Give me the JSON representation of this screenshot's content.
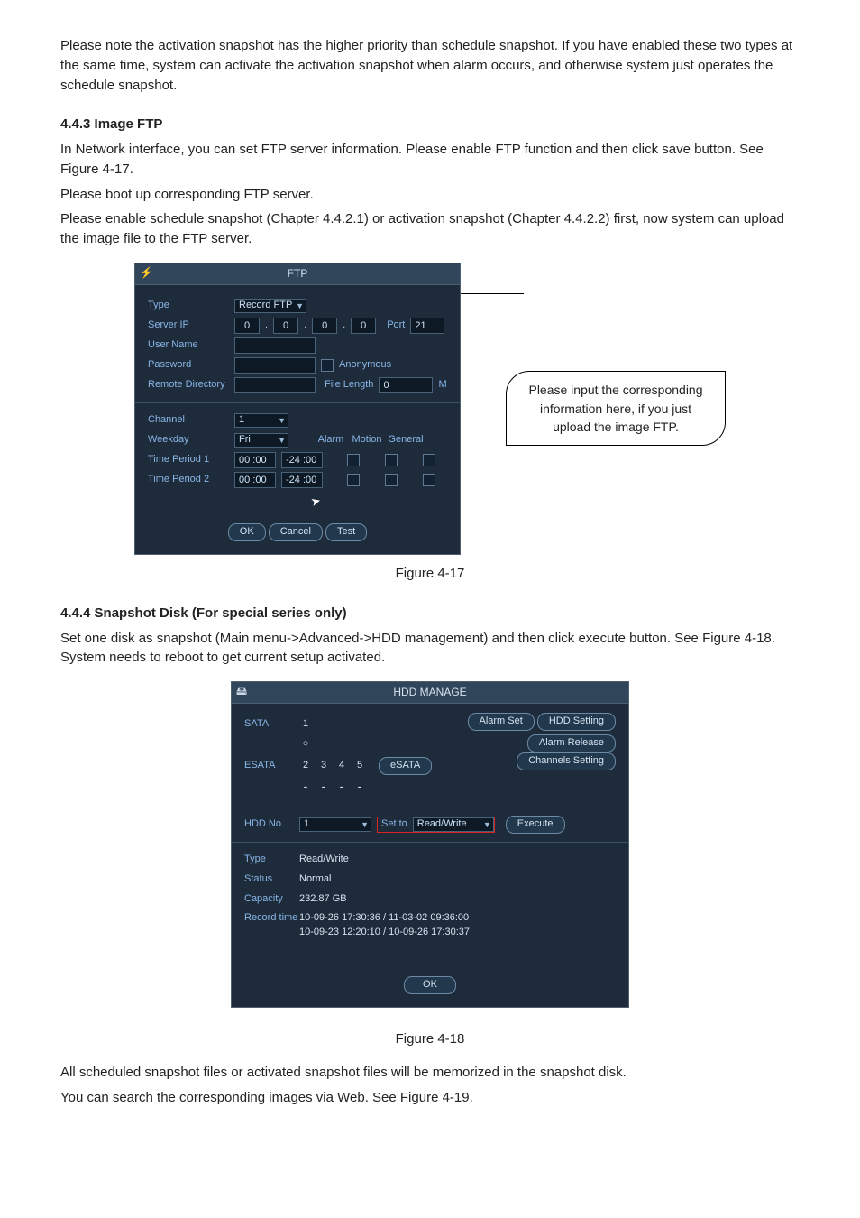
{
  "intro": {
    "p1": "Please note the activation snapshot has the higher priority than schedule snapshot. If you have enabled these two types at the same time, system can activate the activation snapshot when alarm occurs, and otherwise system just operates the schedule snapshot."
  },
  "s443": {
    "heading": "4.4.3  Image FTP",
    "p1": "In Network interface, you can set FTP server information. Please enable FTP function and then click save button. See Figure 4-17.",
    "p2": "Please boot up corresponding FTP server.",
    "p3": "Please enable schedule snapshot (Chapter 4.4.2.1) or activation snapshot (Chapter 4.4.2.2) first, now system can upload the image file to the FTP server."
  },
  "ftp": {
    "title": "FTP",
    "labels": {
      "type": "Type",
      "serverip": "Server IP",
      "username": "User Name",
      "password": "Password",
      "remotedir": "Remote Directory",
      "anonymous": "Anonymous",
      "filelength": "File Length",
      "port": "Port",
      "m": "M",
      "channel": "Channel",
      "weekday": "Weekday",
      "tp1": "Time Period 1",
      "tp2": "Time Period 2",
      "alarm": "Alarm",
      "motion": "Motion",
      "general": "General"
    },
    "values": {
      "type": "Record FTP",
      "ip1": "0",
      "ip2": "0",
      "ip3": "0",
      "ip4": "0",
      "port": "21",
      "filelength": "0",
      "channel": "1",
      "weekday": "Fri",
      "tp1a": "00 :00",
      "tp1b": "-24 :00",
      "tp2a": "00 :00",
      "tp2b": "-24 :00"
    },
    "buttons": {
      "ok": "OK",
      "cancel": "Cancel",
      "test": "Test"
    }
  },
  "callout": "Please input the corresponding information here, if you just upload the image FTP.",
  "fig417": "Figure 4-17",
  "s444": {
    "heading": "4.4.4  Snapshot Disk (For special series only)",
    "p1": "Set one disk as snapshot (Main menu->Advanced->HDD management) and then click execute button. See Figure 4-18. System needs to reboot to get current setup activated."
  },
  "hdd": {
    "title": "HDD MANAGE",
    "labels": {
      "sata": "SATA",
      "esata": "ESATA",
      "hddno": "HDD No.",
      "setto": "Set to",
      "type": "Type",
      "status": "Status",
      "capacity": "Capacity",
      "recordtime": "Record time"
    },
    "values": {
      "sata_row1": [
        "1",
        "",
        "",
        "",
        ""
      ],
      "sata_row2": [
        "○",
        "",
        "",
        "",
        ""
      ],
      "esata_row1": [
        "2",
        "3",
        "4",
        "5"
      ],
      "esata_row2": [
        "-",
        "-",
        "-",
        "-"
      ],
      "hddno": "1",
      "setto": "Read/Write",
      "type": "Read/Write",
      "status": "Normal",
      "capacity": "232.87 GB",
      "rt1": "10-09-26 17:30:36 / 11-03-02 09:36:00",
      "rt2": "10-09-23 12:20:10 / 10-09-26 17:30:37"
    },
    "buttons": {
      "alarmset": "Alarm Set",
      "hddsetting": "HDD Setting",
      "alarmrelease": "Alarm Release",
      "channelssetting": "Channels Setting",
      "esata": "eSATA",
      "execute": "Execute",
      "ok": "OK"
    }
  },
  "fig418": "Figure 4-18",
  "outro": {
    "p1": "All scheduled snapshot files or activated snapshot files will be memorized in the snapshot disk.",
    "p2": "You can search the corresponding images via Web. See Figure 4-19."
  }
}
